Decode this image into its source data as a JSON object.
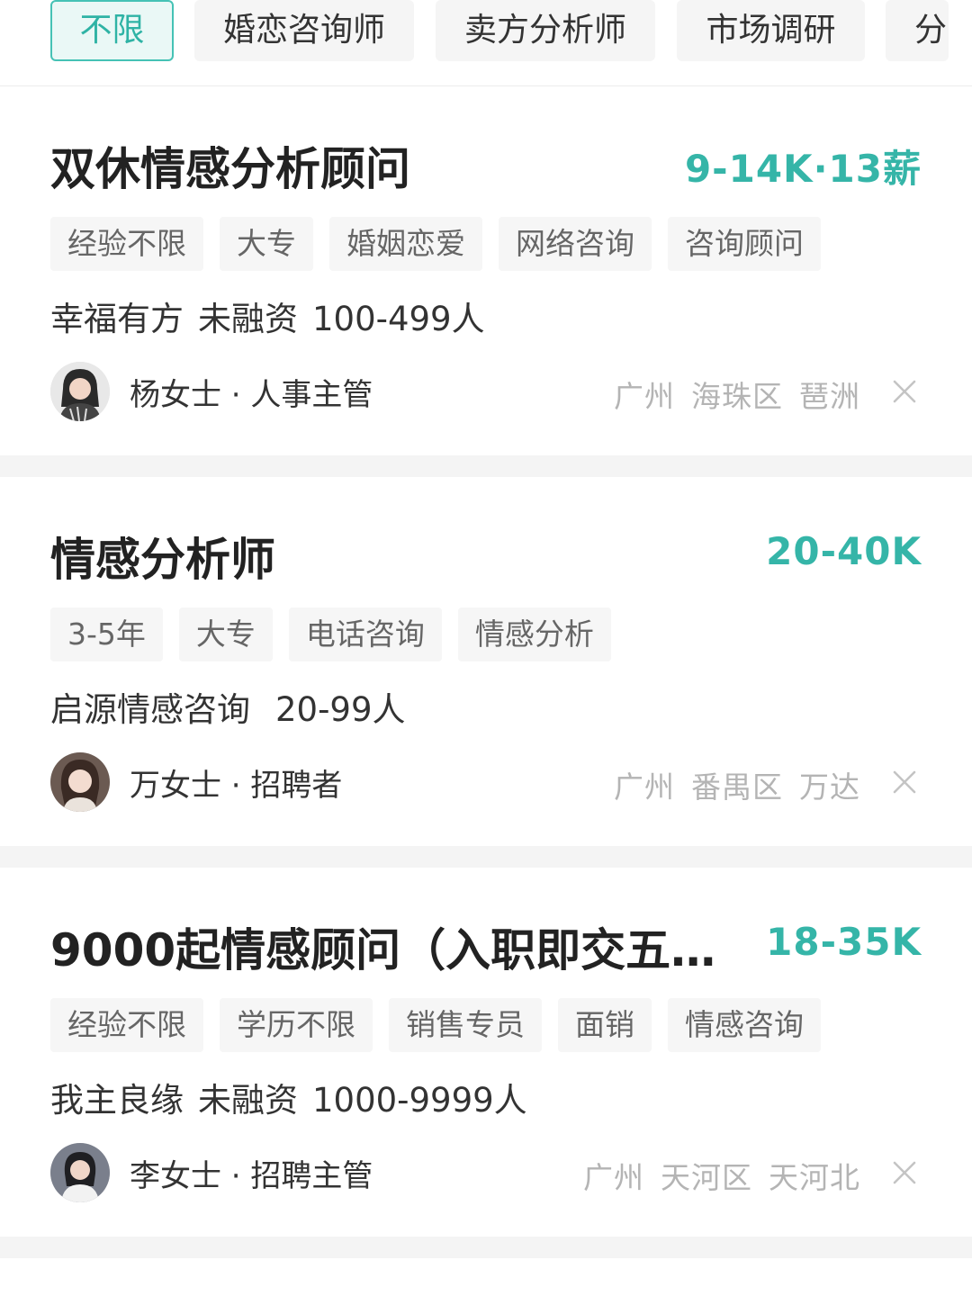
{
  "filters": [
    {
      "label": "不限",
      "active": true
    },
    {
      "label": "婚恋咨询师",
      "active": false
    },
    {
      "label": "卖方分析师",
      "active": false
    },
    {
      "label": "市场调研",
      "active": false
    },
    {
      "label": "分",
      "active": false
    }
  ],
  "jobs": [
    {
      "title": "双休情感分析顾问",
      "salary": "9-14K·13薪",
      "tags": [
        "经验不限",
        "大专",
        "婚姻恋爱",
        "网络咨询",
        "咨询顾问"
      ],
      "company": [
        "幸福有方",
        "未融资",
        "100-499人"
      ],
      "recruiter": "杨女士 · 人事主管",
      "location": [
        "广州",
        "海珠区",
        "琶洲"
      ]
    },
    {
      "title": "情感分析师",
      "salary": "20-40K",
      "tags": [
        "3-5年",
        "大专",
        "电话咨询",
        "情感分析"
      ],
      "company": [
        "启源情感咨询",
        "20-99人"
      ],
      "recruiter": "万女士 · 招聘者",
      "location": [
        "广州",
        "番禺区",
        "万达"
      ]
    },
    {
      "title": "9000起情感顾问（入职即交五险...",
      "salary": "18-35K",
      "tags": [
        "经验不限",
        "学历不限",
        "销售专员",
        "面销",
        "情感咨询"
      ],
      "company": [
        "我主良缘",
        "未融资",
        "1000-9999人"
      ],
      "recruiter": "李女士 · 招聘主管",
      "location": [
        "广州",
        "天河区",
        "天河北"
      ]
    }
  ],
  "colors": {
    "accent": "#35b5a8",
    "active_chip_bg": "#eaf8f6",
    "tag_bg": "#f6f6f6",
    "location_text": "#b4b4b4"
  }
}
